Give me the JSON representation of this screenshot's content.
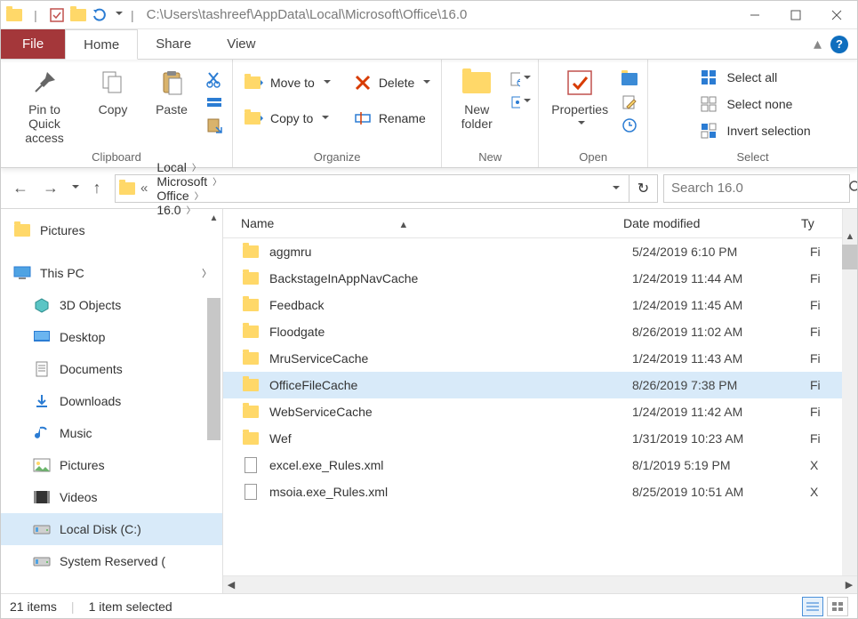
{
  "title_path": "C:\\Users\\tashreef\\AppData\\Local\\Microsoft\\Office\\16.0",
  "tabs": {
    "file": "File",
    "home": "Home",
    "share": "Share",
    "view": "View"
  },
  "ribbon": {
    "clipboard": {
      "pin": "Pin to Quick access",
      "copy": "Copy",
      "paste": "Paste",
      "group": "Clipboard"
    },
    "organize": {
      "move": "Move to",
      "copyto": "Copy to",
      "del": "Delete",
      "rename": "Rename",
      "group": "Organize"
    },
    "new": {
      "newfolder": "New folder",
      "group": "New"
    },
    "open": {
      "properties": "Properties",
      "group": "Open"
    },
    "select": {
      "all": "Select all",
      "none": "Select none",
      "invert": "Invert selection",
      "group": "Select"
    }
  },
  "breadcrumb": [
    "Local",
    "Microsoft",
    "Office",
    "16.0"
  ],
  "search_placeholder": "Search 16.0",
  "nav": [
    {
      "label": "Pictures",
      "icon": "folder",
      "indent": 0
    },
    {
      "label": "This PC",
      "icon": "pc",
      "indent": 0,
      "expanded": true
    },
    {
      "label": "3D Objects",
      "icon": "3d",
      "indent": 1
    },
    {
      "label": "Desktop",
      "icon": "desktop",
      "indent": 1
    },
    {
      "label": "Documents",
      "icon": "doc",
      "indent": 1
    },
    {
      "label": "Downloads",
      "icon": "down",
      "indent": 1
    },
    {
      "label": "Music",
      "icon": "music",
      "indent": 1
    },
    {
      "label": "Pictures",
      "icon": "pic",
      "indent": 1
    },
    {
      "label": "Videos",
      "icon": "vid",
      "indent": 1
    },
    {
      "label": "Local Disk (C:)",
      "icon": "disk",
      "indent": 1,
      "sel": true
    },
    {
      "label": "System Reserved (",
      "icon": "disk",
      "indent": 1
    }
  ],
  "columns": {
    "name": "Name",
    "date": "Date modified",
    "type": "Ty"
  },
  "files": [
    {
      "name": "aggmru",
      "date": "5/24/2019 6:10 PM",
      "type": "Fi",
      "kind": "folder"
    },
    {
      "name": "BackstageInAppNavCache",
      "date": "1/24/2019 11:44 AM",
      "type": "Fi",
      "kind": "folder"
    },
    {
      "name": "Feedback",
      "date": "1/24/2019 11:45 AM",
      "type": "Fi",
      "kind": "folder"
    },
    {
      "name": "Floodgate",
      "date": "8/26/2019 11:02 AM",
      "type": "Fi",
      "kind": "folder"
    },
    {
      "name": "MruServiceCache",
      "date": "1/24/2019 11:43 AM",
      "type": "Fi",
      "kind": "folder"
    },
    {
      "name": "OfficeFileCache",
      "date": "8/26/2019 7:38 PM",
      "type": "Fi",
      "kind": "folder",
      "sel": true
    },
    {
      "name": "WebServiceCache",
      "date": "1/24/2019 11:42 AM",
      "type": "Fi",
      "kind": "folder"
    },
    {
      "name": "Wef",
      "date": "1/31/2019 10:23 AM",
      "type": "Fi",
      "kind": "folder"
    },
    {
      "name": "excel.exe_Rules.xml",
      "date": "8/1/2019 5:19 PM",
      "type": "X",
      "kind": "file"
    },
    {
      "name": "msoia.exe_Rules.xml",
      "date": "8/25/2019 10:51 AM",
      "type": "X",
      "kind": "file"
    }
  ],
  "status": {
    "items": "21 items",
    "sel": "1 item selected"
  }
}
